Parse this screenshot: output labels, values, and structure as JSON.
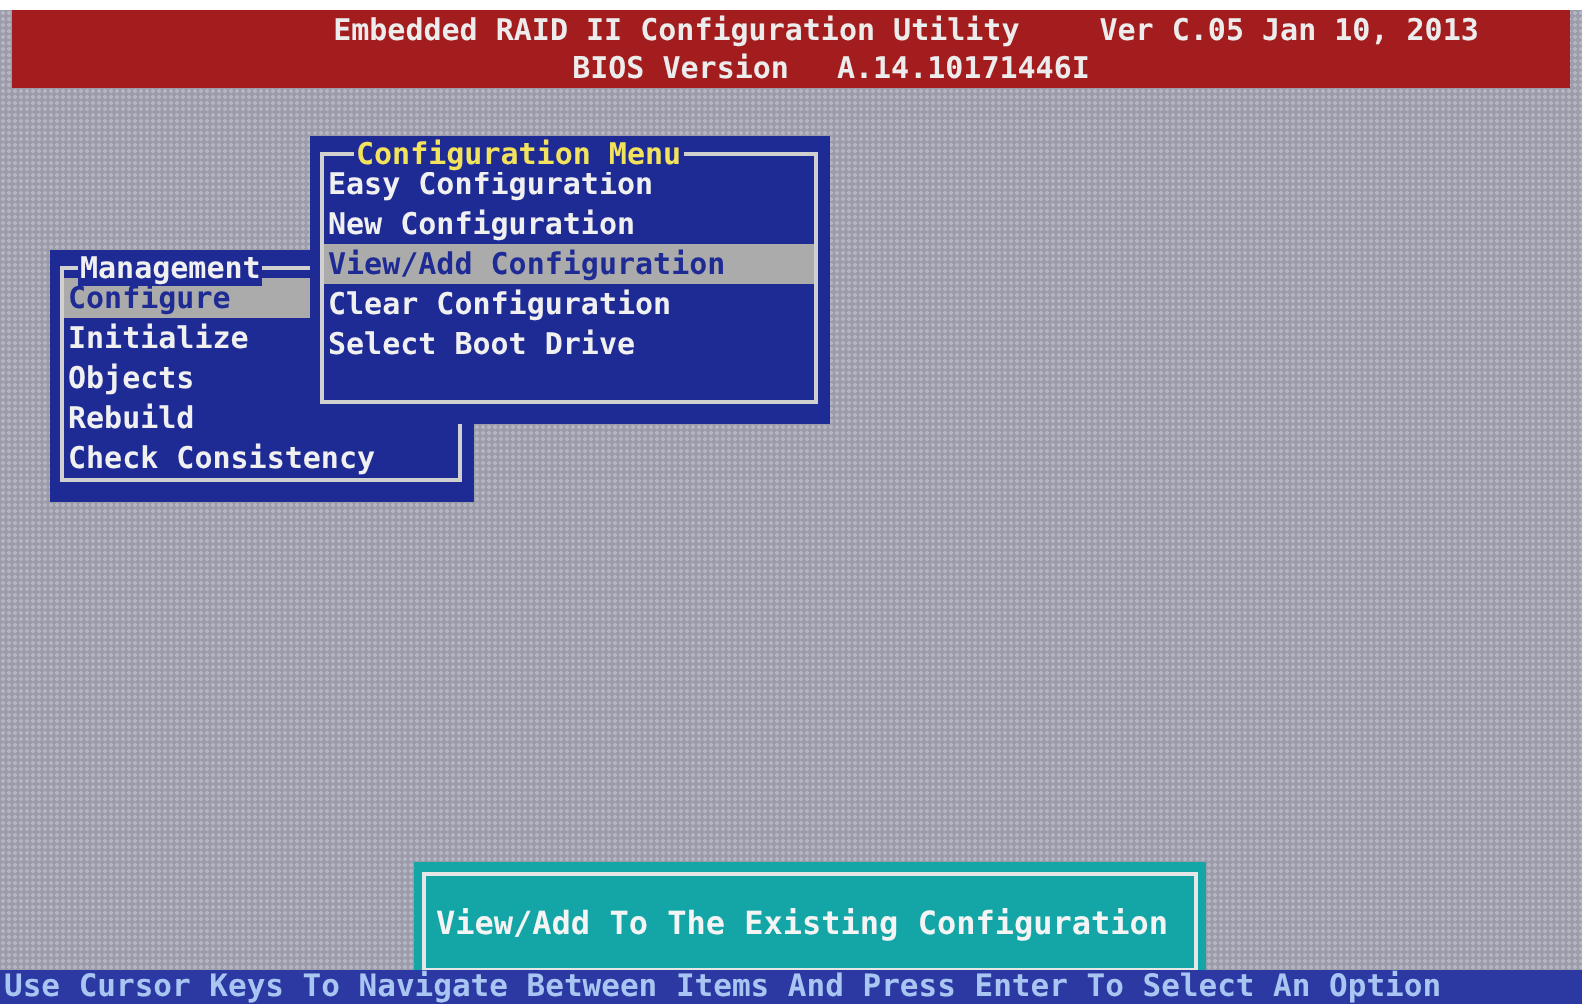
{
  "header": {
    "title": "Embedded RAID II Configuration Utility",
    "version": "Ver C.05 Jan 10, 2013",
    "bios_label": "BIOS Version",
    "bios_version": "A.14.10171446I"
  },
  "management_menu": {
    "title": "Management",
    "items": [
      {
        "label": "Configure",
        "selected": true
      },
      {
        "label": "Initialize",
        "selected": false
      },
      {
        "label": "Objects",
        "selected": false
      },
      {
        "label": "Rebuild",
        "selected": false
      },
      {
        "label": "Check Consistency",
        "selected": false
      }
    ]
  },
  "configuration_menu": {
    "title": "Configuration Menu",
    "items": [
      {
        "label": "Easy Configuration",
        "selected": false
      },
      {
        "label": "New Configuration",
        "selected": false
      },
      {
        "label": "View/Add Configuration",
        "selected": true
      },
      {
        "label": "Clear Configuration",
        "selected": false
      },
      {
        "label": "Select Boot Drive",
        "selected": false
      }
    ]
  },
  "message": "View/Add To The Existing Configuration",
  "status_bar": "Use Cursor Keys To Navigate Between Items And Press Enter To Select An Option"
}
